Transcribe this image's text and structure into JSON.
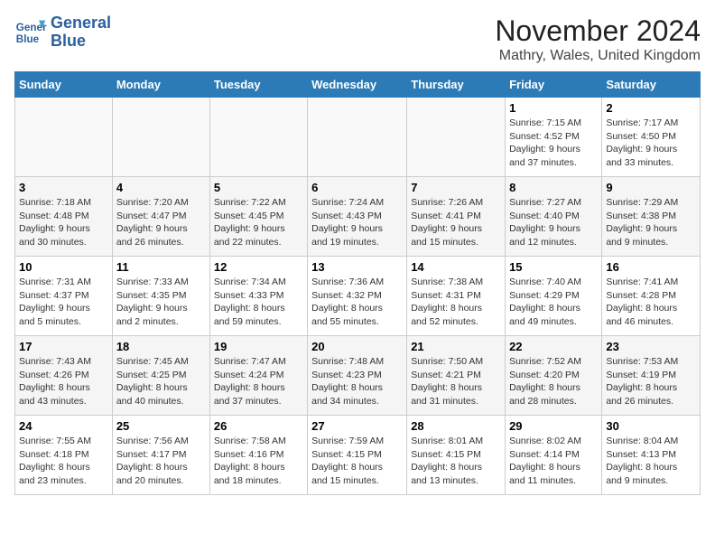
{
  "logo": {
    "line1": "General",
    "line2": "Blue"
  },
  "title": "November 2024",
  "subtitle": "Mathry, Wales, United Kingdom",
  "days_of_week": [
    "Sunday",
    "Monday",
    "Tuesday",
    "Wednesday",
    "Thursday",
    "Friday",
    "Saturday"
  ],
  "weeks": [
    [
      {
        "day": "",
        "info": ""
      },
      {
        "day": "",
        "info": ""
      },
      {
        "day": "",
        "info": ""
      },
      {
        "day": "",
        "info": ""
      },
      {
        "day": "",
        "info": ""
      },
      {
        "day": "1",
        "info": "Sunrise: 7:15 AM\nSunset: 4:52 PM\nDaylight: 9 hours\nand 37 minutes."
      },
      {
        "day": "2",
        "info": "Sunrise: 7:17 AM\nSunset: 4:50 PM\nDaylight: 9 hours\nand 33 minutes."
      }
    ],
    [
      {
        "day": "3",
        "info": "Sunrise: 7:18 AM\nSunset: 4:48 PM\nDaylight: 9 hours\nand 30 minutes."
      },
      {
        "day": "4",
        "info": "Sunrise: 7:20 AM\nSunset: 4:47 PM\nDaylight: 9 hours\nand 26 minutes."
      },
      {
        "day": "5",
        "info": "Sunrise: 7:22 AM\nSunset: 4:45 PM\nDaylight: 9 hours\nand 22 minutes."
      },
      {
        "day": "6",
        "info": "Sunrise: 7:24 AM\nSunset: 4:43 PM\nDaylight: 9 hours\nand 19 minutes."
      },
      {
        "day": "7",
        "info": "Sunrise: 7:26 AM\nSunset: 4:41 PM\nDaylight: 9 hours\nand 15 minutes."
      },
      {
        "day": "8",
        "info": "Sunrise: 7:27 AM\nSunset: 4:40 PM\nDaylight: 9 hours\nand 12 minutes."
      },
      {
        "day": "9",
        "info": "Sunrise: 7:29 AM\nSunset: 4:38 PM\nDaylight: 9 hours\nand 9 minutes."
      }
    ],
    [
      {
        "day": "10",
        "info": "Sunrise: 7:31 AM\nSunset: 4:37 PM\nDaylight: 9 hours\nand 5 minutes."
      },
      {
        "day": "11",
        "info": "Sunrise: 7:33 AM\nSunset: 4:35 PM\nDaylight: 9 hours\nand 2 minutes."
      },
      {
        "day": "12",
        "info": "Sunrise: 7:34 AM\nSunset: 4:33 PM\nDaylight: 8 hours\nand 59 minutes."
      },
      {
        "day": "13",
        "info": "Sunrise: 7:36 AM\nSunset: 4:32 PM\nDaylight: 8 hours\nand 55 minutes."
      },
      {
        "day": "14",
        "info": "Sunrise: 7:38 AM\nSunset: 4:31 PM\nDaylight: 8 hours\nand 52 minutes."
      },
      {
        "day": "15",
        "info": "Sunrise: 7:40 AM\nSunset: 4:29 PM\nDaylight: 8 hours\nand 49 minutes."
      },
      {
        "day": "16",
        "info": "Sunrise: 7:41 AM\nSunset: 4:28 PM\nDaylight: 8 hours\nand 46 minutes."
      }
    ],
    [
      {
        "day": "17",
        "info": "Sunrise: 7:43 AM\nSunset: 4:26 PM\nDaylight: 8 hours\nand 43 minutes."
      },
      {
        "day": "18",
        "info": "Sunrise: 7:45 AM\nSunset: 4:25 PM\nDaylight: 8 hours\nand 40 minutes."
      },
      {
        "day": "19",
        "info": "Sunrise: 7:47 AM\nSunset: 4:24 PM\nDaylight: 8 hours\nand 37 minutes."
      },
      {
        "day": "20",
        "info": "Sunrise: 7:48 AM\nSunset: 4:23 PM\nDaylight: 8 hours\nand 34 minutes."
      },
      {
        "day": "21",
        "info": "Sunrise: 7:50 AM\nSunset: 4:21 PM\nDaylight: 8 hours\nand 31 minutes."
      },
      {
        "day": "22",
        "info": "Sunrise: 7:52 AM\nSunset: 4:20 PM\nDaylight: 8 hours\nand 28 minutes."
      },
      {
        "day": "23",
        "info": "Sunrise: 7:53 AM\nSunset: 4:19 PM\nDaylight: 8 hours\nand 26 minutes."
      }
    ],
    [
      {
        "day": "24",
        "info": "Sunrise: 7:55 AM\nSunset: 4:18 PM\nDaylight: 8 hours\nand 23 minutes."
      },
      {
        "day": "25",
        "info": "Sunrise: 7:56 AM\nSunset: 4:17 PM\nDaylight: 8 hours\nand 20 minutes."
      },
      {
        "day": "26",
        "info": "Sunrise: 7:58 AM\nSunset: 4:16 PM\nDaylight: 8 hours\nand 18 minutes."
      },
      {
        "day": "27",
        "info": "Sunrise: 7:59 AM\nSunset: 4:15 PM\nDaylight: 8 hours\nand 15 minutes."
      },
      {
        "day": "28",
        "info": "Sunrise: 8:01 AM\nSunset: 4:15 PM\nDaylight: 8 hours\nand 13 minutes."
      },
      {
        "day": "29",
        "info": "Sunrise: 8:02 AM\nSunset: 4:14 PM\nDaylight: 8 hours\nand 11 minutes."
      },
      {
        "day": "30",
        "info": "Sunrise: 8:04 AM\nSunset: 4:13 PM\nDaylight: 8 hours\nand 9 minutes."
      }
    ]
  ]
}
